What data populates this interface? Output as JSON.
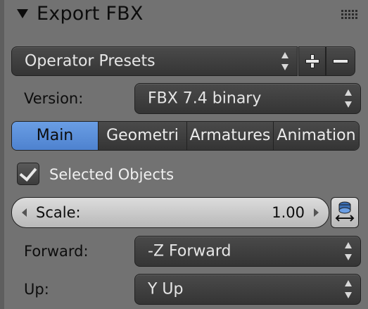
{
  "panel": {
    "title": "Export FBX",
    "presets": {
      "value": "Operator Presets"
    },
    "version": {
      "label": "Version:",
      "value": "FBX 7.4 binary"
    },
    "tabs": [
      {
        "label": "Main",
        "active": true
      },
      {
        "label": "Geometri",
        "active": false
      },
      {
        "label": "Armatures",
        "active": false
      },
      {
        "label": "Animation",
        "active": false
      }
    ],
    "selected_objects": {
      "label": "Selected Objects",
      "checked": true
    },
    "scale": {
      "label": "Scale:",
      "value": "1.00"
    },
    "forward": {
      "label": "Forward:",
      "value": "-Z Forward"
    },
    "up": {
      "label": "Up:",
      "value": "Y Up"
    }
  },
  "colors": {
    "background": "#727272",
    "active_tab": "#5a8fdb",
    "dropdown": "#3f3f3f"
  },
  "icons": [
    "collapse-triangle-icon",
    "grip-icon",
    "plus-icon",
    "minus-icon",
    "checkmark-icon",
    "arrow-left-icon",
    "arrow-right-icon",
    "scale-apply-icon",
    "updown-arrows-icon"
  ]
}
